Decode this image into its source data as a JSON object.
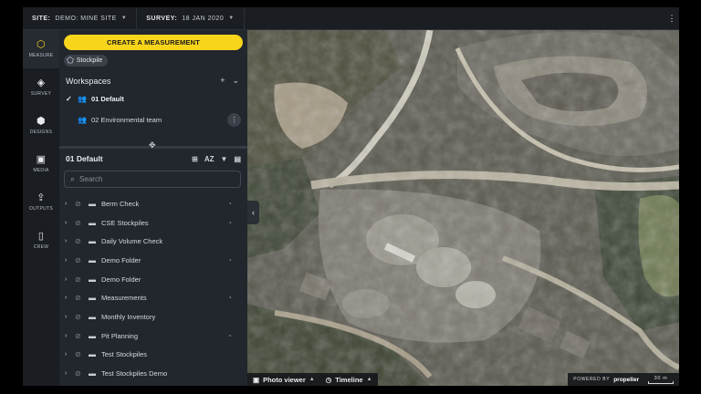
{
  "topbar": {
    "site_label": "SITE:",
    "site_value": "DEMO: MINE SITE",
    "survey_label": "SURVEY:",
    "survey_value": "18 JAN 2020"
  },
  "rail": {
    "items": [
      {
        "label": "MEASURE",
        "icon": "measure-icon"
      },
      {
        "label": "SURVEY",
        "icon": "layers-icon"
      },
      {
        "label": "DESIGNS",
        "icon": "cube-icon"
      },
      {
        "label": "MEDIA",
        "icon": "image-icon"
      },
      {
        "label": "OUTPUTS",
        "icon": "export-icon"
      },
      {
        "label": "CREW",
        "icon": "phone-icon"
      }
    ]
  },
  "panel": {
    "create_label": "CREATE A MEASUREMENT",
    "chip_label": "Stockpile",
    "workspaces_title": "Workspaces",
    "workspaces": [
      {
        "label": "01 Default",
        "selected": true
      },
      {
        "label": "02 Environmental team",
        "selected": false
      }
    ],
    "folder_title": "01 Default",
    "sort_label": "AZ",
    "search_placeholder": "Search",
    "items": [
      {
        "label": "Berm Check",
        "shared": true
      },
      {
        "label": "CSE Stockpiles",
        "shared": true
      },
      {
        "label": "Daily Volume Check",
        "shared": false
      },
      {
        "label": "Demo Folder",
        "shared": true
      },
      {
        "label": "Demo Folder",
        "shared": false
      },
      {
        "label": "Measurements",
        "shared": true
      },
      {
        "label": "Monthly Inventory",
        "shared": false
      },
      {
        "label": "Pit Planning",
        "shared": true
      },
      {
        "label": "Test Stockpiles",
        "shared": false
      },
      {
        "label": "Test Stockpiles Demo",
        "shared": false
      }
    ]
  },
  "map": {
    "photo_viewer_label": "Photo viewer",
    "timeline_label": "Timeline",
    "powered_label": "POWERED BY",
    "brand": "propeller",
    "scale_label": "30 m"
  },
  "colors": {
    "accent": "#f7d51b",
    "panel": "#22262d",
    "rail": "#1a1d22"
  }
}
